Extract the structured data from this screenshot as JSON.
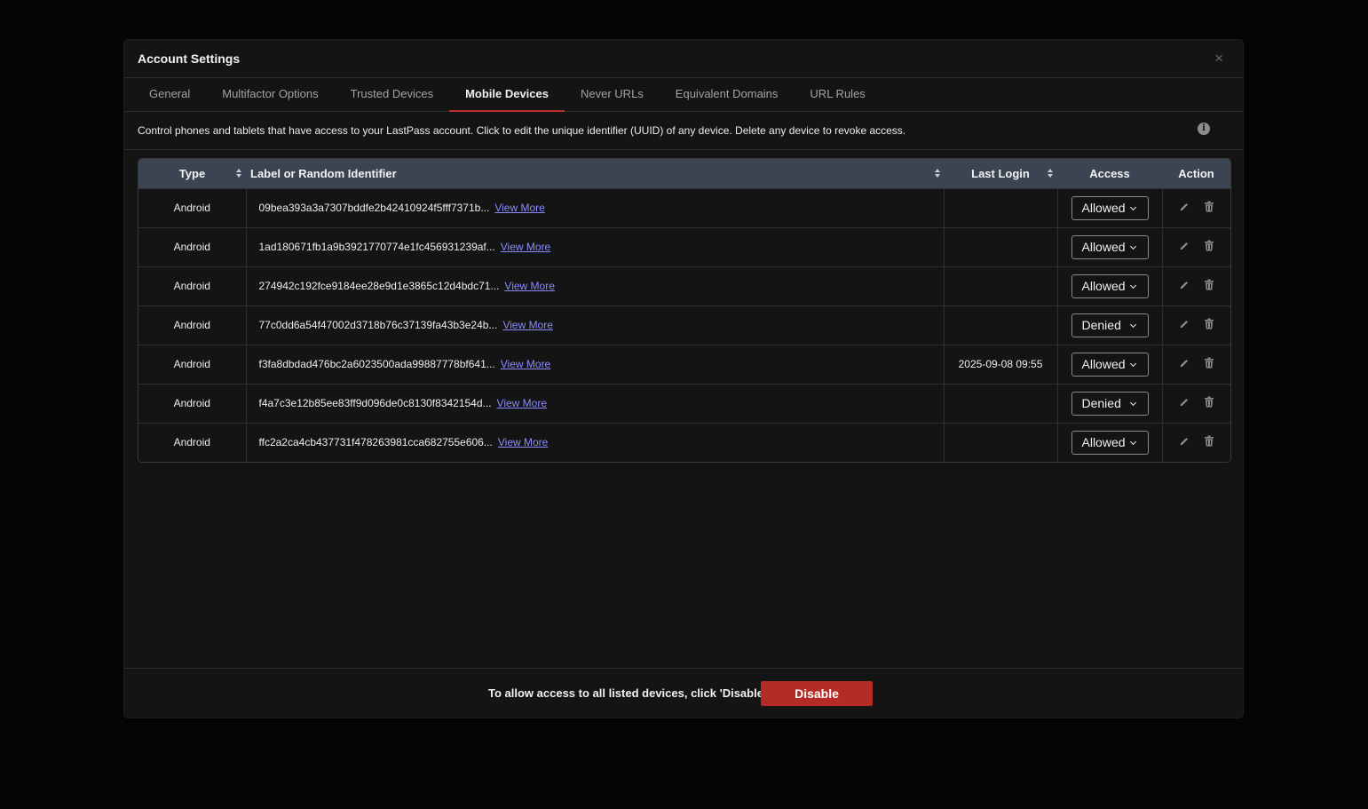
{
  "modal": {
    "title": "Account Settings",
    "close_label": "×"
  },
  "tabs": [
    {
      "label": "General"
    },
    {
      "label": "Multifactor Options"
    },
    {
      "label": "Trusted Devices"
    },
    {
      "label": "Mobile Devices",
      "active": true
    },
    {
      "label": "Never URLs"
    },
    {
      "label": "Equivalent Domains"
    },
    {
      "label": "URL Rules"
    }
  ],
  "description": "Control phones and tablets that have access to your LastPass account. Click to edit the unique identifier (UUID) of any device. Delete any device to revoke access.",
  "info_icon_glyph": "i",
  "table": {
    "headers": {
      "type": "Type",
      "label": "Label or Random Identifier",
      "last_login": "Last Login",
      "access": "Access",
      "action": "Action"
    },
    "view_more_label": "View More",
    "rows": [
      {
        "type": "Android",
        "id": "09bea393a3a7307bddfe2b42410924f5fff7371b...",
        "last_login": "",
        "access": "Allowed"
      },
      {
        "type": "Android",
        "id": "1ad180671fb1a9b3921770774e1fc456931239af...",
        "last_login": "",
        "access": "Allowed"
      },
      {
        "type": "Android",
        "id": "274942c192fce9184ee28e9d1e3865c12d4bdc71...",
        "last_login": "",
        "access": "Allowed"
      },
      {
        "type": "Android",
        "id": "77c0dd6a54f47002d3718b76c37139fa43b3e24b...",
        "last_login": "",
        "access": "Denied"
      },
      {
        "type": "Android",
        "id": "f3fa8dbdad476bc2a6023500ada99887778bf641...",
        "last_login": "2025-09-08 09:55",
        "access": "Allowed"
      },
      {
        "type": "Android",
        "id": "f4a7c3e12b85ee83ff9d096de0c8130f8342154d...",
        "last_login": "",
        "access": "Denied"
      },
      {
        "type": "Android",
        "id": "ffc2a2ca4cb437731f478263981cca682755e606...",
        "last_login": "",
        "access": "Allowed"
      }
    ]
  },
  "footer": {
    "text": "To allow access to all listed devices, click 'Disable'",
    "disable_label": "Disable",
    "disable_color": "#b52c27"
  },
  "colors": {
    "accent_tab_underline": "#b9302b",
    "header_row": "#3b4453",
    "link": "#8c8cff"
  },
  "icons": {
    "edit": "pencil-icon",
    "delete": "trash-icon",
    "info": "info-icon",
    "close": "close-icon"
  }
}
